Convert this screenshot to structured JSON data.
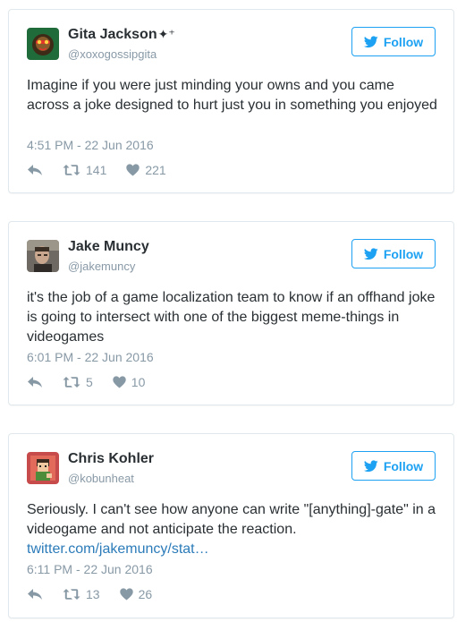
{
  "colors": {
    "accent": "#1da1f2",
    "link": "#2b7bb9",
    "muted": "#8899a6",
    "text": "#292f33",
    "border": "#e1e8ed"
  },
  "tweets": [
    {
      "name": "Gita Jackson",
      "name_suffix": "✦⁺",
      "handle": "@xoxogossipgita",
      "follow_label": "Follow",
      "text": "Imagine if you were just minding your owns and you came across a joke designed to hurt just you in something you enjoyed",
      "link": "",
      "timestamp": "4:51 PM - 22 Jun 2016",
      "retweets": "141",
      "likes": "221"
    },
    {
      "name": "Jake Muncy",
      "name_suffix": "",
      "handle": "@jakemuncy",
      "follow_label": "Follow",
      "text": "it's the job of a game localization team to know if an offhand joke is going to intersect with one of the biggest meme-things in videogames",
      "link": "",
      "timestamp": "6:01 PM - 22 Jun 2016",
      "retweets": "5",
      "likes": "10"
    },
    {
      "name": "Chris Kohler",
      "name_suffix": "",
      "handle": "@kobunheat",
      "follow_label": "Follow",
      "text": "Seriously. I can't see how anyone can write \"[anything]-gate\" in a videogame and not anticipate the reaction.",
      "link": "twitter.com/jakemuncy/stat…",
      "timestamp": "6:11 PM - 22 Jun 2016",
      "retweets": "13",
      "likes": "26"
    }
  ]
}
